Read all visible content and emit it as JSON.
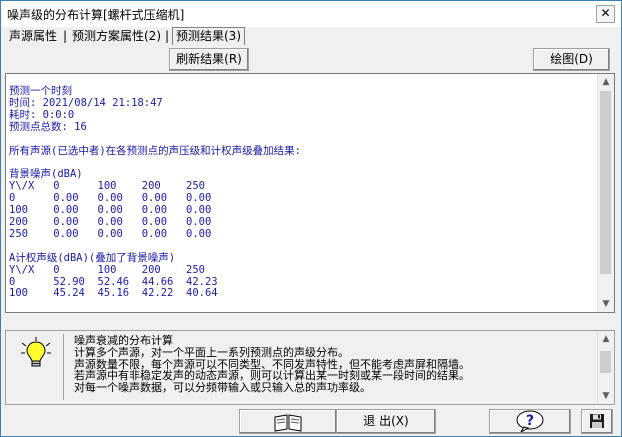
{
  "window": {
    "title": "噪声级的分布计算[螺杆式压缩机]",
    "close": "✕"
  },
  "tabs": [
    {
      "label": "声源属性"
    },
    {
      "label": "预测方案属性(2)"
    },
    {
      "label": "预测结果(3)"
    }
  ],
  "tab_separator": "|",
  "toolbar": {
    "refresh_label": "刷新结果(R)",
    "plot_label": "绘图(D)"
  },
  "results": {
    "lines": [
      "预测一个时刻",
      "时间: 2021/08/14 21:18:47",
      "耗时: 0:0:0",
      "预测点总数: 16",
      "",
      "所有声源(已选中者)在各预测点的声压级和计权声级叠加结果:",
      "",
      "背景噪声(dBA)",
      "Y\\/X   0      100    200    250",
      "0      0.00   0.00   0.00   0.00",
      "100    0.00   0.00   0.00   0.00",
      "200    0.00   0.00   0.00   0.00",
      "250    0.00   0.00   0.00   0.00",
      "",
      "A计权声级(dBA)(叠加了背景噪声)",
      "Y\\/X   0      100    200    250",
      "0      52.90  52.46  44.66  42.23",
      "100    45.24  45.16  42.22  40.64"
    ]
  },
  "help": {
    "lines": [
      "噪声衰减的分布计算",
      "计算多个声源，对一个平面上一系列预测点的声级分布。",
      "声源数量不限，每个声源可以不同类型、不同发声特性，但不能考虑声屏和隔墙。",
      "若声源中有非稳定发声的动态声源，则可以计算出某一时刻或某一段时间的结果。",
      "对每一个噪声数据，可以分频带输入或只输入总的声功率级。"
    ]
  },
  "bottom": {
    "exit_label": "退 出(X)",
    "help_glyph": "?"
  },
  "colors": {
    "text_blue": "#1a1aa8",
    "border": "#7a7a7a",
    "accent": "#3c7fb1"
  }
}
